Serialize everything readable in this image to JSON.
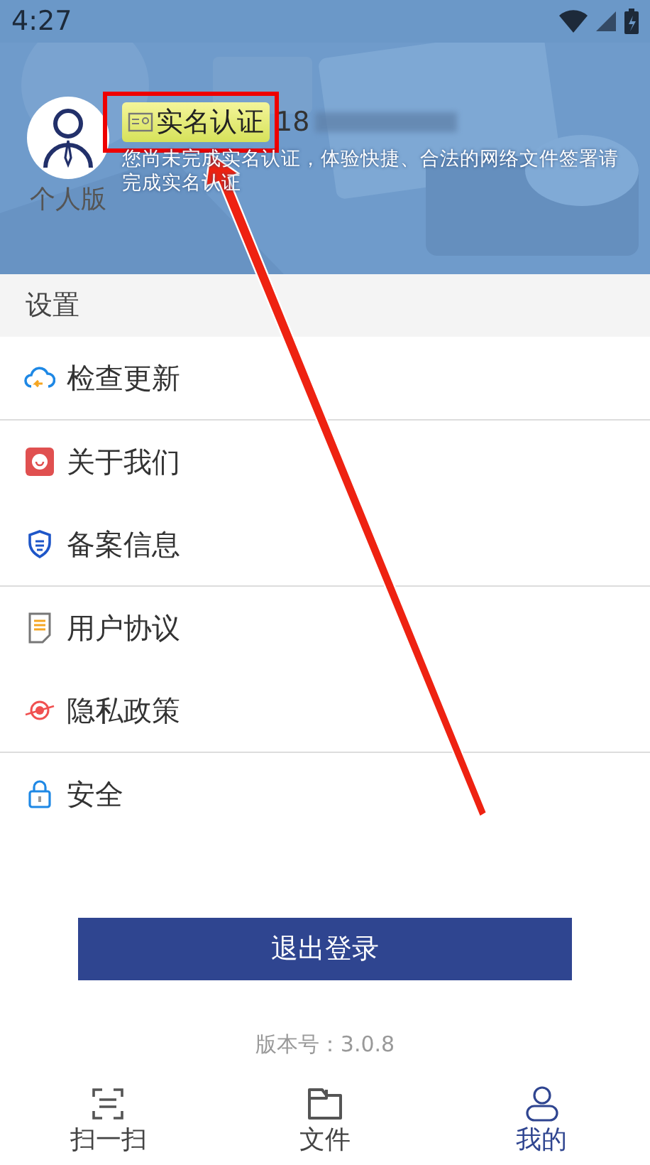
{
  "status_bar": {
    "time": "4:27"
  },
  "profile": {
    "edition": "个人版",
    "badge": "实名认证",
    "phone": "18",
    "notice": "您尚未完成实名认证，体验快捷、合法的网络文件签署请完成实名认证"
  },
  "section": {
    "title": "设置"
  },
  "groups": [
    [
      {
        "kind": "update",
        "label": "检查更新"
      }
    ],
    [
      {
        "kind": "about",
        "label": "关于我们"
      },
      {
        "kind": "record",
        "label": "备案信息"
      }
    ],
    [
      {
        "kind": "agreement",
        "label": "用户协议"
      },
      {
        "kind": "privacy",
        "label": "隐私政策"
      }
    ],
    [
      {
        "kind": "security",
        "label": "安全"
      }
    ]
  ],
  "logout_button": "退出登录",
  "version": "版本号：3.0.8",
  "tabs": [
    {
      "kind": "scan",
      "label": "扫一扫",
      "selected": false
    },
    {
      "kind": "files",
      "label": "文件",
      "selected": false
    },
    {
      "kind": "mine",
      "label": "我的",
      "selected": true
    }
  ]
}
